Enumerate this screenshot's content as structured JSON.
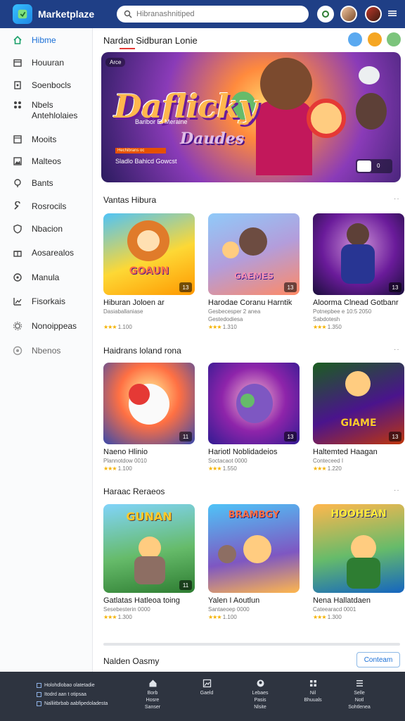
{
  "app": {
    "name": "Marketplaze"
  },
  "search": {
    "placeholder": "Hibranashnitiped"
  },
  "sidebar": {
    "items": [
      {
        "label": "Hibme",
        "icon": "home-icon"
      },
      {
        "label": "Houuran",
        "icon": "store-icon"
      },
      {
        "label": "Soenbocls",
        "icon": "book-icon"
      },
      {
        "label": "Nbels Antehlolaies",
        "icon": "apps-icon"
      },
      {
        "label": "Mooits",
        "icon": "window-icon"
      },
      {
        "label": "Malteos",
        "icon": "image-icon"
      },
      {
        "label": "Bants",
        "icon": "pin-icon"
      },
      {
        "label": "Rosrocils",
        "icon": "wrench-icon"
      },
      {
        "label": "Nbacion",
        "icon": "shield-icon"
      },
      {
        "label": "Aosarealos",
        "icon": "gift-icon"
      },
      {
        "label": "Manula",
        "icon": "circle-icon"
      },
      {
        "label": "Fisorkais",
        "icon": "chart-icon"
      },
      {
        "label": "Nonoippeas",
        "icon": "gear-icon"
      },
      {
        "label": "Nbenos",
        "icon": "help-icon"
      }
    ]
  },
  "main": {
    "page_title": "Nardan Sidburan Lonie",
    "hero": {
      "tag": "Arce",
      "title": "Daflicky",
      "subtitle": "Baribor El Meraine",
      "subtitle2": "Daudes",
      "bar_text": "Hechibrans oc",
      "caption": "Sladlo Bahicd Gowcst",
      "nav_index": "0"
    },
    "sections": [
      {
        "title": "Vantas Hibura",
        "more": "··",
        "cards": [
          {
            "title": "Hiburan Joloen  ar",
            "sub": "Dasiaballaniase",
            "rating": "1.100",
            "badge": "13",
            "word": "GOAUN"
          },
          {
            "title": "Harodae Coranu Harntik",
            "sub": "Gesbecesper 2 anea",
            "sub2": "Gestedodiesa",
            "rating": "1.310",
            "badge": "13",
            "word": "GAEMES"
          },
          {
            "title": "Aloorma Clnead Gotbanr",
            "sub": "Potnepbee e 10:5 2050",
            "sub2": "Sabdotesh",
            "rating": "1.350",
            "badge": "13",
            "word": ""
          }
        ]
      },
      {
        "title": "Haidrans loland rona",
        "more": "··",
        "cards": [
          {
            "title": "Naeno Hlinio",
            "sub": "Plannotdow   0010",
            "rating": "1.100",
            "badge": "11",
            "word": ""
          },
          {
            "title": "Hariotl Noblidadeios",
            "sub": "Soctacaot  0000",
            "rating": "1.550",
            "badge": "13",
            "word": ""
          },
          {
            "title": "Haltemted Haagan",
            "sub": "Conteceed  I",
            "rating": "1.220",
            "badge": "13",
            "word": "GIAME"
          }
        ]
      },
      {
        "title": "Haraac Reraeos",
        "more": "··",
        "cards": [
          {
            "title": "Gatlatas Hatleoa toing",
            "sub": "Sesebesterin  0000",
            "rating": "1.300",
            "badge": "11",
            "word": "GUNAN"
          },
          {
            "title": "Yalen I Aoutlun",
            "sub": "Santaeoep  0000",
            "rating": "1.100",
            "badge": "",
            "word": "BRAMBGY"
          },
          {
            "title": "Nena Hallatdaen",
            "sub": "Cateearacd  0001",
            "rating": "1.300",
            "badge": "",
            "word": "HOOHEAN"
          }
        ]
      }
    ],
    "footer_note": "Nalden Oasmy",
    "footer_button": "Conteam"
  },
  "bottom": {
    "left_items": [
      "Holohdlobao olatetadie",
      "Itodrd aan t otipsaa",
      "Nalliitbrbab aabfipedoladesta"
    ],
    "nav": [
      {
        "icon": "home-icon",
        "lines": [
          "Borb",
          "Hosre",
          "Sanser"
        ]
      },
      {
        "icon": "image-icon",
        "lines": [
          "Gaeld"
        ]
      },
      {
        "icon": "user-icon",
        "lines": [
          "Lebaes",
          "Pasis",
          "Nlsite"
        ]
      },
      {
        "icon": "grid-icon",
        "lines": [
          "Nil",
          "Bhuuals"
        ]
      },
      {
        "icon": "list-icon",
        "lines": [
          "Selle",
          "Notl",
          "Sohtlenea"
        ]
      }
    ]
  }
}
